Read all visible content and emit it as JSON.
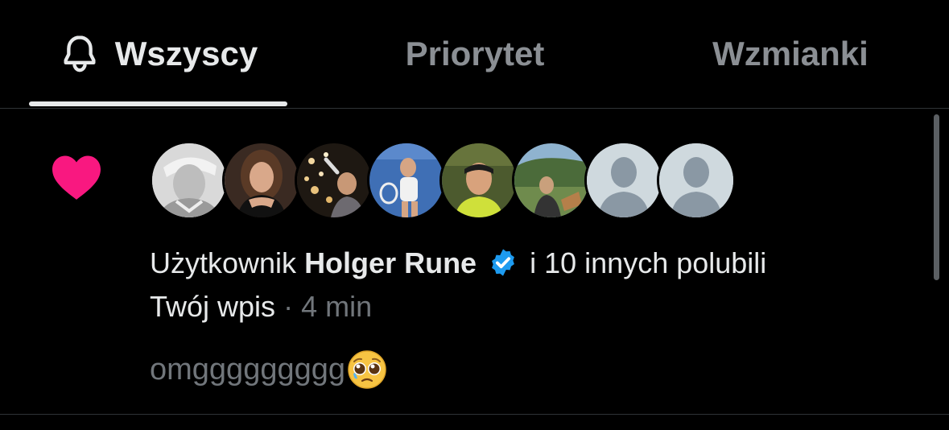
{
  "tabs": {
    "all_label": "Wszyscy",
    "priority_label": "Priorytet",
    "mentions_label": "Wzmianki"
  },
  "notification": {
    "type_icon": "heart-icon",
    "avatar_count": 8,
    "prefix": "Użytkownik",
    "user_name": "Holger Rune",
    "verified_icon": "verified-badge-icon",
    "suffix": "i 10 innych polubili",
    "target": "Twój wpis",
    "separator": "·",
    "time": "4 min",
    "post_preview": "omggggggggg",
    "emoji": "pleading-face-emoji"
  },
  "colors": {
    "heart": "#f91880",
    "verified": "#1d9bf0",
    "muted": "#71767b",
    "text": "#e7e9ea"
  }
}
